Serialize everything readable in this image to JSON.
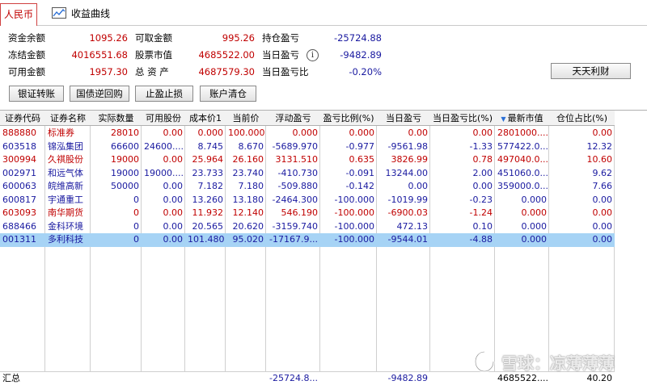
{
  "tabs": {
    "rmb": "人民币",
    "curve": "收益曲线"
  },
  "summary": {
    "fund_balance_label": "资金余额",
    "fund_balance": "1095.26",
    "frozen_label": "冻结金额",
    "frozen": "4016551.68",
    "available_label": "可用金额",
    "available": "1957.30",
    "withdrawable_label": "可取金额",
    "withdrawable": "995.26",
    "stock_value_label": "股票市值",
    "stock_value": "4685522.00",
    "total_assets_label": "总 资 产",
    "total_assets": "4687579.30",
    "position_pl_label": "持仓盈亏",
    "position_pl": "-25724.88",
    "daily_pl_label": "当日盈亏",
    "daily_pl": "-9482.89",
    "daily_pl_ratio_label": "当日盈亏比",
    "daily_pl_ratio": "-0.20%",
    "info_icon": "i"
  },
  "buttons": {
    "ttlc": "天天利财",
    "transfer": "银证转账",
    "reverse_repo": "国债逆回购",
    "stop": "止盈止损",
    "clear": "账户清仓"
  },
  "table": {
    "headers": [
      "证券代码",
      "证券名称",
      "实际数量",
      "可用股份",
      "成本价1",
      "当前价",
      "浮动盈亏",
      "盈亏比例(%)",
      "当日盈亏",
      "当日盈亏比(%)",
      "最新市值",
      "仓位占比(%)"
    ],
    "rows": [
      {
        "code": "888880",
        "name": "标准券",
        "qty": "28010",
        "avail": "0.00",
        "cost": "0.000",
        "price": "100.000",
        "float_pl": "0.000",
        "pl_ratio": "0.000",
        "day_pl": "0.00",
        "day_ratio": "0.00",
        "mkt": "2801000....",
        "pos": "0.00",
        "color": "red"
      },
      {
        "code": "603518",
        "name": "锦泓集团",
        "qty": "66600",
        "avail": "24600....",
        "cost": "8.745",
        "price": "8.670",
        "float_pl": "-5689.970",
        "pl_ratio": "-0.977",
        "day_pl": "-9561.98",
        "day_ratio": "-1.33",
        "mkt": "577422.0...",
        "pos": "12.32",
        "color": "blue"
      },
      {
        "code": "300994",
        "name": "久祺股份",
        "qty": "19000",
        "avail": "0.00",
        "cost": "25.964",
        "price": "26.160",
        "float_pl": "3131.510",
        "pl_ratio": "0.635",
        "day_pl": "3826.99",
        "day_ratio": "0.78",
        "mkt": "497040.0...",
        "pos": "10.60",
        "color": "red"
      },
      {
        "code": "002971",
        "name": "和远气体",
        "qty": "19000",
        "avail": "19000....",
        "cost": "23.733",
        "price": "23.740",
        "float_pl": "-410.730",
        "pl_ratio": "-0.091",
        "day_pl": "13244.00",
        "day_ratio": "2.00",
        "mkt": "451060.0...",
        "pos": "9.62",
        "color": "blue"
      },
      {
        "code": "600063",
        "name": "皖维高新",
        "qty": "50000",
        "avail": "0.00",
        "cost": "7.182",
        "price": "7.180",
        "float_pl": "-509.880",
        "pl_ratio": "-0.142",
        "day_pl": "0.00",
        "day_ratio": "0.00",
        "mkt": "359000.0...",
        "pos": "7.66",
        "color": "blue"
      },
      {
        "code": "600817",
        "name": "宇通重工",
        "qty": "0",
        "avail": "0.00",
        "cost": "13.260",
        "price": "13.180",
        "float_pl": "-2464.300",
        "pl_ratio": "-100.000",
        "day_pl": "-1019.99",
        "day_ratio": "-0.23",
        "mkt": "0.000",
        "pos": "0.00",
        "color": "blue"
      },
      {
        "code": "603093",
        "name": "南华期货",
        "qty": "0",
        "avail": "0.00",
        "cost": "11.932",
        "price": "12.140",
        "float_pl": "546.190",
        "pl_ratio": "-100.000",
        "day_pl": "-6900.03",
        "day_ratio": "-1.24",
        "mkt": "0.000",
        "pos": "0.00",
        "color": "red"
      },
      {
        "code": "688466",
        "name": "金科环境",
        "qty": "0",
        "avail": "0.00",
        "cost": "20.565",
        "price": "20.620",
        "float_pl": "-3159.740",
        "pl_ratio": "-100.000",
        "day_pl": "472.13",
        "day_ratio": "0.10",
        "mkt": "0.000",
        "pos": "0.00",
        "color": "blue"
      },
      {
        "code": "001311",
        "name": "多利科技",
        "qty": "0",
        "avail": "0.00",
        "cost": "101.480",
        "price": "95.020",
        "float_pl": "-17167.9...",
        "pl_ratio": "-100.000",
        "day_pl": "-9544.01",
        "day_ratio": "-4.88",
        "mkt": "0.000",
        "pos": "0.00",
        "color": "blue",
        "selected": true
      }
    ],
    "total": {
      "label": "汇总",
      "float_pl": "-25724.8...",
      "day_pl": "-9482.89",
      "mkt": "4685522....",
      "pos": "40.20"
    }
  },
  "watermark": {
    "text": "雪球：凉薄薄薄"
  },
  "colors": {
    "red": "#c00000",
    "blue": "#1a1aa0",
    "selected": "#a6d3f5"
  }
}
